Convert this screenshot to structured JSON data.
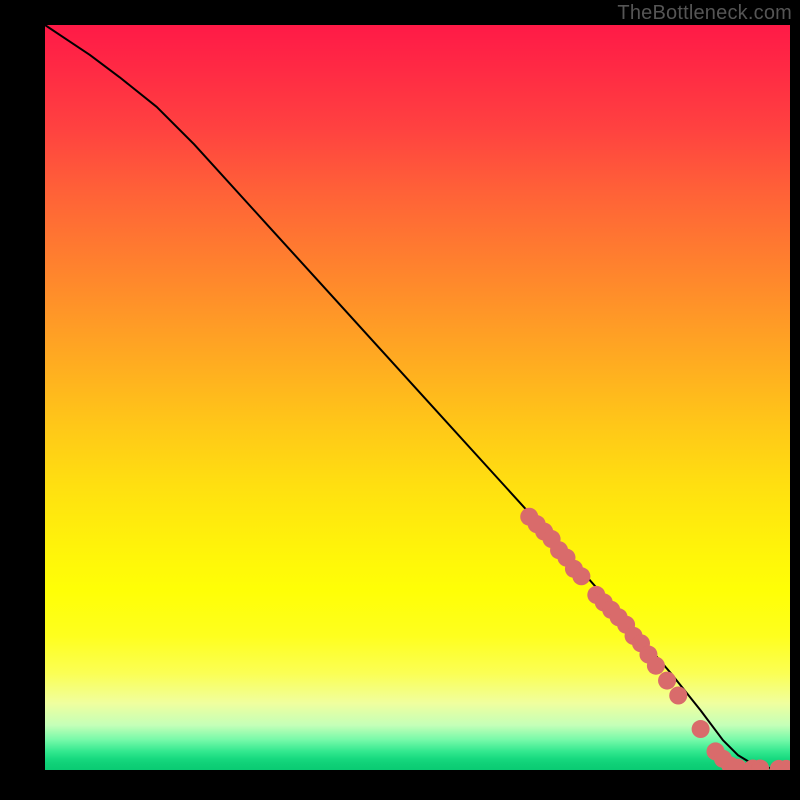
{
  "watermark": "TheBottleneck.com",
  "chart_data": {
    "type": "line",
    "title": "",
    "xlabel": "",
    "ylabel": "",
    "xlim": [
      0,
      100
    ],
    "ylim": [
      0,
      100
    ],
    "grid": false,
    "series": [
      {
        "name": "curve",
        "x": [
          0,
          3,
          6,
          10,
          15,
          20,
          30,
          40,
          50,
          60,
          70,
          78,
          84,
          88,
          91,
          93,
          95,
          97,
          99,
          100
        ],
        "y": [
          100,
          98,
          96,
          93,
          89,
          84,
          73,
          62,
          51,
          40,
          29,
          20,
          13,
          8,
          4,
          2,
          0.8,
          0.3,
          0.1,
          0.1
        ]
      }
    ],
    "markers": {
      "name": "highlight-points",
      "color": "#d96b6b",
      "radius_px": 9,
      "points": [
        {
          "x": 65,
          "y": 34
        },
        {
          "x": 66,
          "y": 33
        },
        {
          "x": 67,
          "y": 32
        },
        {
          "x": 68,
          "y": 31
        },
        {
          "x": 69,
          "y": 29.5
        },
        {
          "x": 70,
          "y": 28.5
        },
        {
          "x": 71,
          "y": 27
        },
        {
          "x": 72,
          "y": 26
        },
        {
          "x": 74,
          "y": 23.5
        },
        {
          "x": 75,
          "y": 22.5
        },
        {
          "x": 76,
          "y": 21.5
        },
        {
          "x": 77,
          "y": 20.5
        },
        {
          "x": 78,
          "y": 19.5
        },
        {
          "x": 79,
          "y": 18
        },
        {
          "x": 80,
          "y": 17
        },
        {
          "x": 81,
          "y": 15.5
        },
        {
          "x": 82,
          "y": 14
        },
        {
          "x": 83.5,
          "y": 12
        },
        {
          "x": 85,
          "y": 10
        },
        {
          "x": 88,
          "y": 5.5
        },
        {
          "x": 90,
          "y": 2.5
        },
        {
          "x": 91,
          "y": 1.5
        },
        {
          "x": 92,
          "y": 0.6
        },
        {
          "x": 93,
          "y": 0.3
        },
        {
          "x": 95,
          "y": 0.2
        },
        {
          "x": 96,
          "y": 0.2
        },
        {
          "x": 98.5,
          "y": 0.15
        },
        {
          "x": 99.5,
          "y": 0.15
        }
      ]
    },
    "background_gradient": {
      "top": "#ff1a47",
      "mid": "#ffe010",
      "bottom": "#0acb73"
    }
  }
}
